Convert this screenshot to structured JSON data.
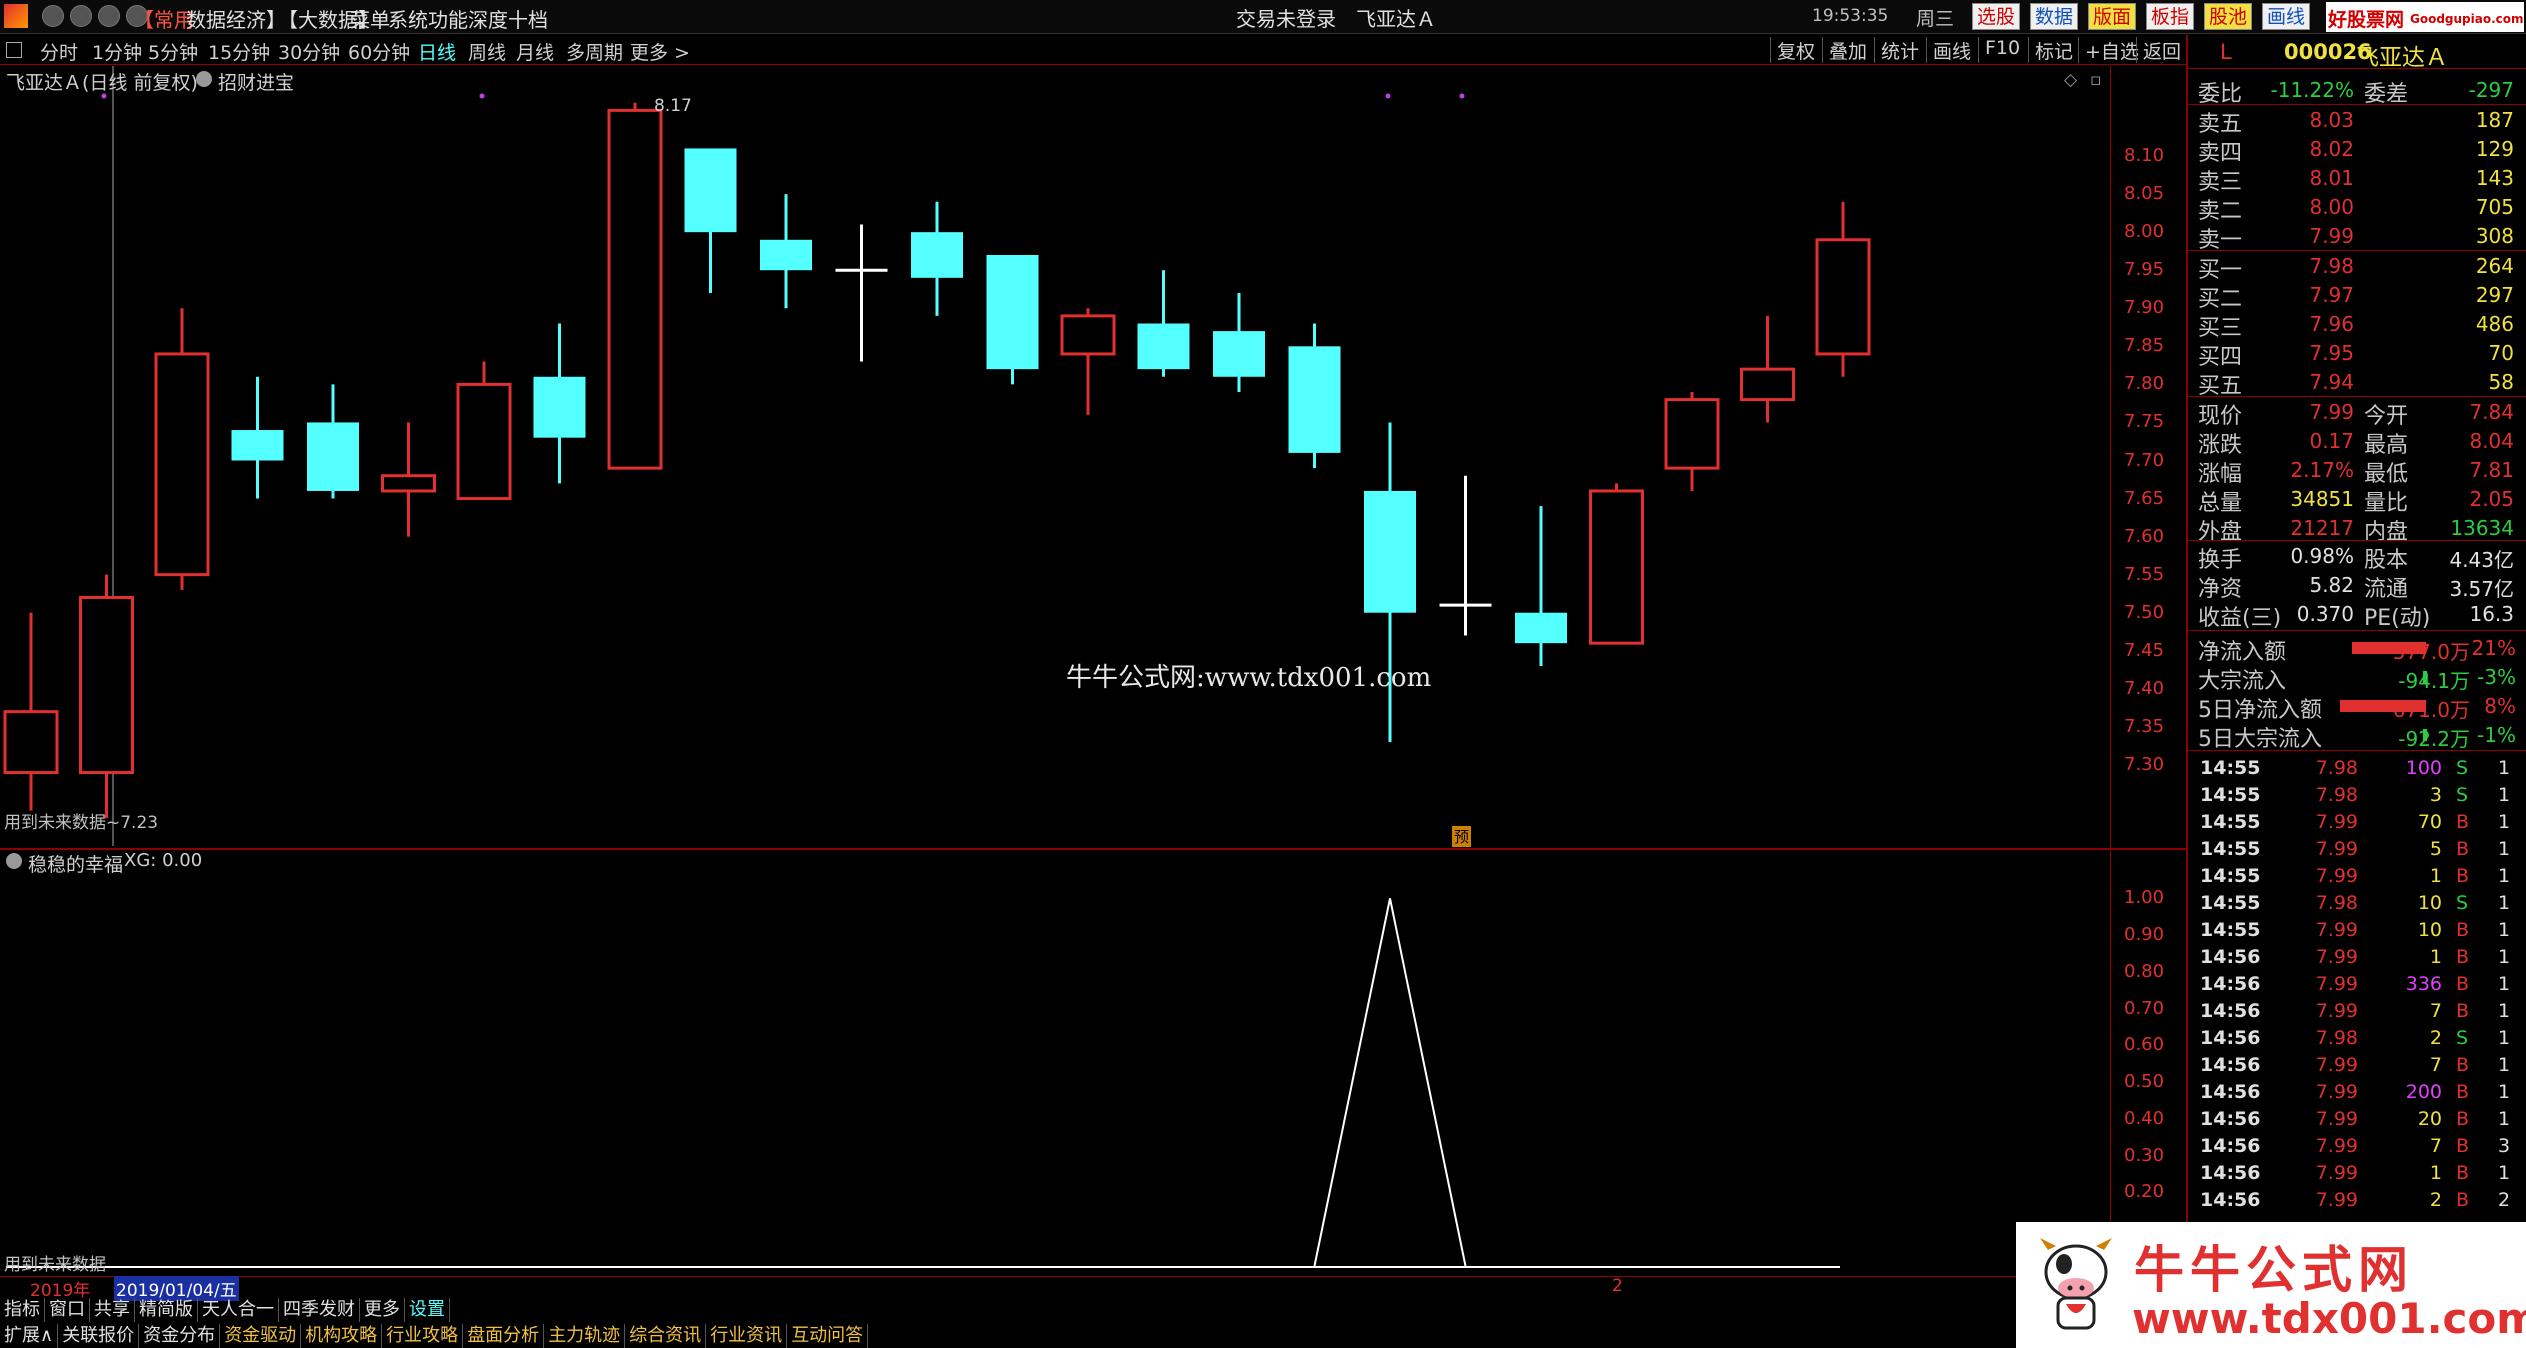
{
  "menubar": {
    "items": [
      "【常用",
      "数据",
      "经济】",
      "【大数据】",
      "菜单",
      "系统",
      "功能",
      "深度",
      "十档"
    ],
    "login_status": "交易未登录",
    "stock_name": "飞亚达Ａ",
    "clock": "19:53:35",
    "weekday": "周三",
    "right_buttons": [
      "选股",
      "数据",
      "版面",
      "板指",
      "股池",
      "画线"
    ],
    "brand": "好股票网",
    "brand_url": "Goodgupiao.com"
  },
  "toolbar": {
    "periods": [
      "分时",
      "1分钟",
      "5分钟",
      "15分钟",
      "30分钟",
      "60分钟",
      "日线",
      "周线",
      "月线",
      "多周期",
      "更多 >"
    ],
    "active_period": "日线",
    "right_items": [
      "复权",
      "叠加",
      "统计",
      "画线",
      "F10",
      "标记",
      "+自选",
      "返回"
    ]
  },
  "main_chart": {
    "title": "飞亚达Ａ(日线 前复权)",
    "indicator": "招财进宝",
    "high_label": "8.17",
    "low_label": "用到未来数据~7.23",
    "watermark": "牛牛公式网:www.tdx001.com",
    "pre_mark": "预"
  },
  "sub_chart": {
    "title": "稳稳的幸福",
    "xg_label": "XG: 0.00",
    "bottom_label": "用到未来数据"
  },
  "chart_data": [
    {
      "type": "candlestick",
      "ylim": [
        7.25,
        8.15
      ],
      "yticks": [
        "8.10",
        "8.05",
        "8.00",
        "7.95",
        "7.90",
        "7.85",
        "7.80",
        "7.75",
        "7.70",
        "7.65",
        "7.60",
        "7.55",
        "7.50",
        "7.45",
        "7.40",
        "7.35",
        "7.30"
      ],
      "candles": [
        {
          "o": 7.29,
          "h": 7.5,
          "l": 7.24,
          "c": 7.37
        },
        {
          "o": 7.29,
          "h": 7.55,
          "l": 7.23,
          "c": 7.52
        },
        {
          "o": 7.55,
          "h": 7.9,
          "l": 7.53,
          "c": 7.84
        },
        {
          "o": 7.74,
          "h": 7.81,
          "l": 7.65,
          "c": 7.7
        },
        {
          "o": 7.75,
          "h": 7.8,
          "l": 7.65,
          "c": 7.66
        },
        {
          "o": 7.66,
          "h": 7.75,
          "l": 7.6,
          "c": 7.68
        },
        {
          "o": 7.65,
          "h": 7.83,
          "l": 7.65,
          "c": 7.8
        },
        {
          "o": 7.81,
          "h": 7.88,
          "l": 7.67,
          "c": 7.73
        },
        {
          "o": 7.69,
          "h": 8.17,
          "l": 7.69,
          "c": 8.16
        },
        {
          "o": 8.11,
          "h": 8.11,
          "l": 7.92,
          "c": 8.0
        },
        {
          "o": 7.99,
          "h": 8.05,
          "l": 7.9,
          "c": 7.95
        },
        {
          "o": 7.95,
          "h": 8.01,
          "l": 7.83,
          "c": 7.95
        },
        {
          "o": 8.0,
          "h": 8.04,
          "l": 7.89,
          "c": 7.94
        },
        {
          "o": 7.97,
          "h": 7.97,
          "l": 7.8,
          "c": 7.82
        },
        {
          "o": 7.84,
          "h": 7.9,
          "l": 7.76,
          "c": 7.89
        },
        {
          "o": 7.88,
          "h": 7.95,
          "l": 7.81,
          "c": 7.82
        },
        {
          "o": 7.87,
          "h": 7.92,
          "l": 7.79,
          "c": 7.81
        },
        {
          "o": 7.85,
          "h": 7.88,
          "l": 7.69,
          "c": 7.71
        },
        {
          "o": 7.66,
          "h": 7.75,
          "l": 7.33,
          "c": 7.5
        },
        {
          "o": 7.5,
          "h": 7.68,
          "l": 7.47,
          "c": 7.51
        },
        {
          "o": 7.5,
          "h": 7.64,
          "l": 7.43,
          "c": 7.46
        },
        {
          "o": 7.46,
          "h": 7.67,
          "l": 7.46,
          "c": 7.66
        },
        {
          "o": 7.69,
          "h": 7.79,
          "l": 7.66,
          "c": 7.78
        },
        {
          "o": 7.78,
          "h": 7.89,
          "l": 7.75,
          "c": 7.82
        },
        {
          "o": 7.84,
          "h": 8.04,
          "l": 7.81,
          "c": 7.99
        }
      ],
      "up_color": "#e0302f",
      "down_color": "#54ffff",
      "doji_color": "#ffffff"
    },
    {
      "type": "line",
      "ylim": [
        0.0,
        1.05
      ],
      "yticks": [
        "1.00",
        "0.90",
        "0.80",
        "0.70",
        "0.60",
        "0.50",
        "0.40",
        "0.30",
        "0.20"
      ],
      "values": [
        0,
        0,
        0,
        0,
        0,
        0,
        0,
        0,
        0,
        0,
        0,
        0,
        0,
        0,
        0,
        0,
        0,
        0,
        1,
        0,
        0,
        0,
        0,
        0,
        0
      ],
      "line_color": "#ffffff"
    }
  ],
  "timeline": {
    "year": "2019年",
    "date": "2019/01/04/五",
    "marker": "2"
  },
  "bottom_tabs": {
    "row1": [
      "指标",
      "窗口",
      "共享",
      "精简版",
      "天人合一",
      "四季发财",
      "更多",
      "设置"
    ],
    "row2": [
      "扩展∧",
      "关联报价",
      "资金分布",
      "资金驱动",
      "机构攻略",
      "行业攻略",
      "盘面分析",
      "主力轨迹",
      "综合资讯",
      "行业资讯",
      "互动问答"
    ]
  },
  "right_panel": {
    "code": "000026",
    "name": "飞亚达Ａ",
    "tag": "L",
    "weibi_label": "委比",
    "weibi": "-11.22%",
    "weicha_label": "委差",
    "weicha": "-297",
    "sell": [
      {
        "label": "卖五",
        "price": "8.03",
        "vol": "187"
      },
      {
        "label": "卖四",
        "price": "8.02",
        "vol": "129"
      },
      {
        "label": "卖三",
        "price": "8.01",
        "vol": "143"
      },
      {
        "label": "卖二",
        "price": "8.00",
        "vol": "705"
      },
      {
        "label": "卖一",
        "price": "7.99",
        "vol": "308"
      }
    ],
    "buy": [
      {
        "label": "买一",
        "price": "7.98",
        "vol": "264"
      },
      {
        "label": "买二",
        "price": "7.97",
        "vol": "297"
      },
      {
        "label": "买三",
        "price": "7.96",
        "vol": "486"
      },
      {
        "label": "买四",
        "price": "7.95",
        "vol": "70"
      },
      {
        "label": "买五",
        "price": "7.94",
        "vol": "58"
      }
    ],
    "quote": [
      {
        "l1": "现价",
        "v1": "7.99",
        "l2": "今开",
        "v2": "7.84"
      },
      {
        "l1": "涨跌",
        "v1": "0.17",
        "l2": "最高",
        "v2": "8.04"
      },
      {
        "l1": "涨幅",
        "v1": "2.17%",
        "l2": "最低",
        "v2": "7.81"
      },
      {
        "l1": "总量",
        "v1": "34851",
        "l2": "量比",
        "v2": "2.05"
      },
      {
        "l1": "外盘",
        "v1": "21217",
        "l2": "内盘",
        "v2": "13634"
      }
    ],
    "fund": [
      {
        "l1": "换手",
        "v1": "0.98%",
        "l2": "股本",
        "v2": "4.43亿"
      },
      {
        "l1": "净资",
        "v1": "5.82",
        "l2": "流通",
        "v2": "3.57亿"
      },
      {
        "l1": "收益(三)",
        "v1": "0.370",
        "l2": "PE(动)",
        "v2": "16.3"
      }
    ],
    "flow": [
      {
        "label": "净流入额",
        "value": "577.0万",
        "pct": "21%",
        "bar": 0.86,
        "color": "#e0302f"
      },
      {
        "label": "大宗流入",
        "value": "-94.1万",
        "pct": "-3%",
        "bar": 0.04,
        "color": "#2ecc40"
      },
      {
        "label": "5日净流入额",
        "value": "671.0万",
        "pct": "8%",
        "bar": 1.0,
        "color": "#e0302f"
      },
      {
        "label": "5日大宗流入",
        "value": "-92.2万",
        "pct": "-1%",
        "bar": 0.03,
        "color": "#2ecc40"
      }
    ],
    "ticks": [
      {
        "t": "14:55",
        "p": "7.98",
        "v": "100",
        "s": "S",
        "n": "1",
        "vc": "#e040fb"
      },
      {
        "t": "14:55",
        "p": "7.98",
        "v": "3",
        "s": "S",
        "n": "1",
        "vc": "#f0e040"
      },
      {
        "t": "14:55",
        "p": "7.99",
        "v": "70",
        "s": "B",
        "n": "1",
        "vc": "#f0e040"
      },
      {
        "t": "14:55",
        "p": "7.99",
        "v": "5",
        "s": "B",
        "n": "1",
        "vc": "#f0e040"
      },
      {
        "t": "14:55",
        "p": "7.99",
        "v": "1",
        "s": "B",
        "n": "1",
        "vc": "#f0e040"
      },
      {
        "t": "14:55",
        "p": "7.98",
        "v": "10",
        "s": "S",
        "n": "1",
        "vc": "#f0e040"
      },
      {
        "t": "14:55",
        "p": "7.99",
        "v": "10",
        "s": "B",
        "n": "1",
        "vc": "#f0e040"
      },
      {
        "t": "14:56",
        "p": "7.99",
        "v": "1",
        "s": "B",
        "n": "1",
        "vc": "#f0e040"
      },
      {
        "t": "14:56",
        "p": "7.99",
        "v": "336",
        "s": "B",
        "n": "1",
        "vc": "#e040fb"
      },
      {
        "t": "14:56",
        "p": "7.99",
        "v": "7",
        "s": "B",
        "n": "1",
        "vc": "#f0e040"
      },
      {
        "t": "14:56",
        "p": "7.98",
        "v": "2",
        "s": "S",
        "n": "1",
        "vc": "#f0e040"
      },
      {
        "t": "14:56",
        "p": "7.99",
        "v": "7",
        "s": "B",
        "n": "1",
        "vc": "#f0e040"
      },
      {
        "t": "14:56",
        "p": "7.99",
        "v": "200",
        "s": "B",
        "n": "1",
        "vc": "#e040fb"
      },
      {
        "t": "14:56",
        "p": "7.99",
        "v": "20",
        "s": "B",
        "n": "1",
        "vc": "#f0e040"
      },
      {
        "t": "14:56",
        "p": "7.99",
        "v": "7",
        "s": "B",
        "n": "3",
        "vc": "#f0e040"
      },
      {
        "t": "14:56",
        "p": "7.99",
        "v": "1",
        "s": "B",
        "n": "1",
        "vc": "#f0e040"
      },
      {
        "t": "14:56",
        "p": "7.99",
        "v": "2",
        "s": "B",
        "n": "2",
        "vc": "#f0e040"
      }
    ]
  },
  "ad_banner": {
    "title": "牛牛公式网",
    "url": "www.tdx001.com"
  }
}
